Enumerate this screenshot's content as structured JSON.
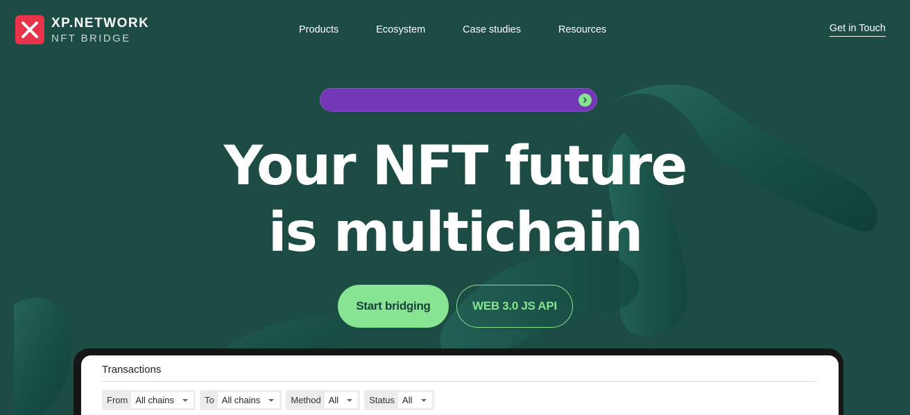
{
  "brand": {
    "title": "XP.NETWORK",
    "subtitle": "NFT BRIDGE",
    "logo_icon": "xp-logo-icon",
    "color": "#e8334a"
  },
  "nav": {
    "items": [
      "Products",
      "Ecosystem",
      "Case studies",
      "Resources"
    ],
    "cta": "Get in Touch"
  },
  "announcement": {
    "arrow_icon": "arrow-right-icon",
    "color": "#7437b8"
  },
  "hero": {
    "line1": "Your NFT future",
    "line2": "is multichain",
    "primary_button": "Start bridging",
    "secondary_button": "WEB 3.0 JS API",
    "accent": "#86e493"
  },
  "transactions": {
    "title": "Transactions",
    "filters": [
      {
        "label": "From",
        "value": "All chains"
      },
      {
        "label": "To",
        "value": "All chains"
      },
      {
        "label": "Method",
        "value": "All"
      },
      {
        "label": "Status",
        "value": "All"
      }
    ]
  }
}
